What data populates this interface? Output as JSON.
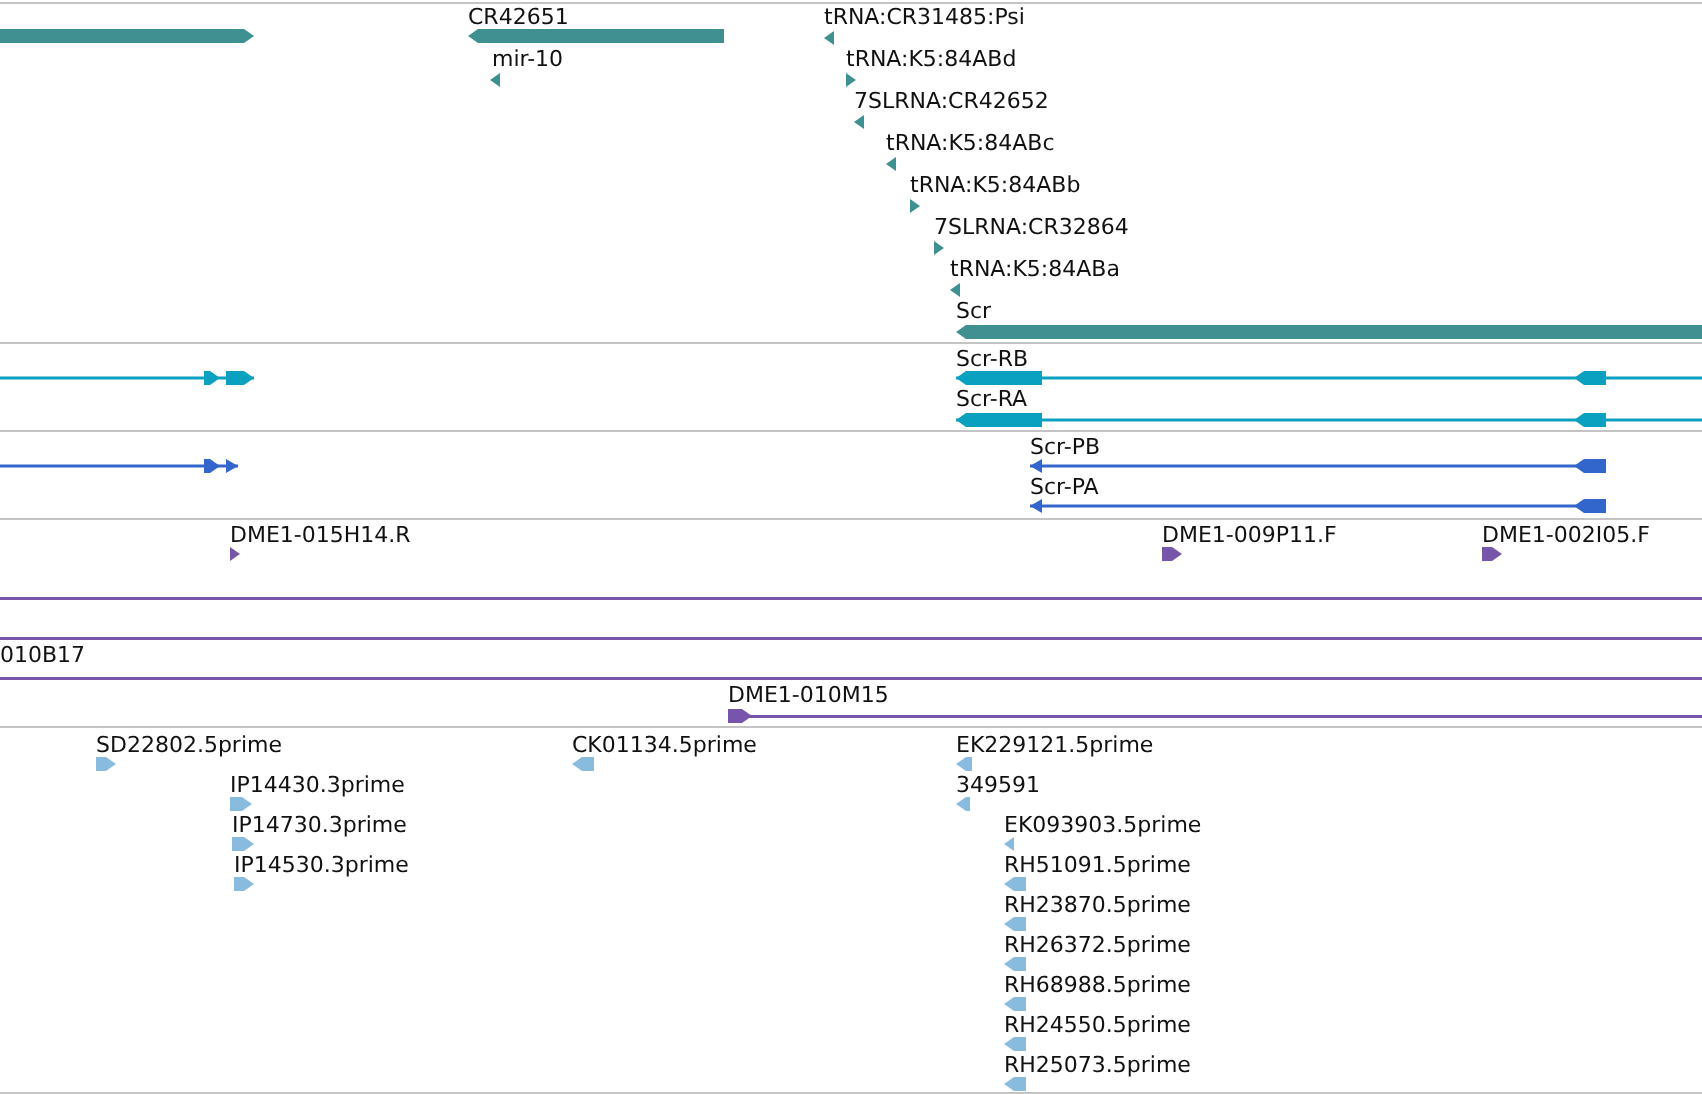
{
  "tracks": [
    {
      "kind": "gene",
      "features": [
        {
          "kind": "arrow",
          "reverse": false
        },
        {
          "kind": "arrow",
          "reverse": true,
          "label": "CR42651"
        },
        {
          "kind": "arrow",
          "reverse": true,
          "label": "mir-10"
        },
        {
          "kind": "arrow",
          "reverse": true,
          "label": "tRNA:CR31485:Psi"
        },
        {
          "kind": "arrow",
          "reverse": false,
          "label": "tRNA:K5:84ABd"
        },
        {
          "kind": "arrow",
          "reverse": true,
          "label": "7SLRNA:CR42652"
        },
        {
          "kind": "arrow",
          "reverse": true,
          "label": "tRNA:K5:84ABc"
        },
        {
          "kind": "arrow",
          "reverse": false,
          "label": "tRNA:K5:84ABb"
        },
        {
          "kind": "arrow",
          "reverse": false,
          "label": "7SLRNA:CR32864"
        },
        {
          "kind": "arrow",
          "reverse": true,
          "label": "tRNA:K5:84ABa"
        },
        {
          "kind": "arrow",
          "reverse": true,
          "label": "Scr"
        }
      ]
    },
    {
      "kind": "transcript",
      "features": [
        {
          "kind": "transcript",
          "reverse": false
        },
        {
          "kind": "transcript",
          "reverse": true,
          "label": "Scr-RB"
        },
        {
          "kind": "transcript",
          "reverse": true,
          "label": "Scr-RA"
        }
      ]
    },
    {
      "kind": "protein",
      "features": [
        {
          "kind": "transcript",
          "reverse": false
        },
        {
          "kind": "transcript",
          "reverse": true,
          "label": "Scr-PB"
        },
        {
          "kind": "transcript",
          "reverse": true,
          "label": "Scr-PA"
        }
      ]
    },
    {
      "kind": "clone",
      "features": [
        {
          "kind": "arrow",
          "reverse": false,
          "label": "DME1-015H14.R"
        },
        {
          "kind": "arrow",
          "reverse": false,
          "label": "DME1-009P11.F"
        },
        {
          "kind": "arrow",
          "reverse": false,
          "label": "DME1-002I05.F"
        },
        {
          "kind": "span"
        },
        {
          "kind": "span"
        },
        {
          "kind": "span",
          "label": "010B17"
        },
        {
          "kind": "span",
          "reverse": false,
          "label": "DME1-010M15"
        }
      ]
    },
    {
      "kind": "est",
      "features": [
        {
          "kind": "arrow",
          "reverse": false,
          "label": "SD22802.5prime"
        },
        {
          "kind": "arrow",
          "reverse": false,
          "label": "IP14430.3prime"
        },
        {
          "kind": "arrow",
          "reverse": false,
          "label": "IP14730.3prime"
        },
        {
          "kind": "arrow",
          "reverse": false,
          "label": "IP14530.3prime"
        },
        {
          "kind": "arrow",
          "reverse": true,
          "label": "CK01134.5prime"
        },
        {
          "kind": "arrow",
          "reverse": true,
          "label": "EK229121.5prime"
        },
        {
          "kind": "arrow",
          "reverse": true,
          "label": "349591"
        },
        {
          "kind": "arrow",
          "reverse": true,
          "label": "EK093903.5prime"
        },
        {
          "kind": "arrow",
          "reverse": true,
          "label": "RH51091.5prime"
        },
        {
          "kind": "arrow",
          "reverse": true,
          "label": "RH23870.5prime"
        },
        {
          "kind": "arrow",
          "reverse": true,
          "label": "RH26372.5prime"
        },
        {
          "kind": "arrow",
          "reverse": true,
          "label": "RH68988.5prime"
        },
        {
          "kind": "arrow",
          "reverse": true,
          "label": "RH24550.5prime"
        },
        {
          "kind": "arrow",
          "reverse": true,
          "label": "RH25073.5prime"
        }
      ]
    }
  ]
}
